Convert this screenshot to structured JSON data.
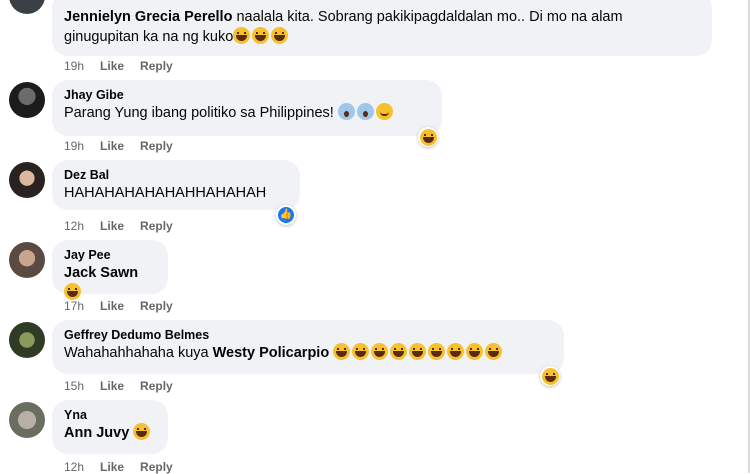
{
  "comments": [
    {
      "author": "Jennielyn Grecia Perello",
      "text_line1": "naalala kita. Sobrang pakikipagdaldalan mo.. Di mo na alam",
      "text_line2": "ginugupitan ka na ng kuko",
      "emojis": [
        "grinning-squint-icon",
        "grinning-squint-icon",
        "grinning-squint-icon"
      ],
      "time": "19h",
      "like_label": "Like",
      "reply_label": "Reply"
    },
    {
      "author": "Jhay Gibe",
      "text": "Parang Yung ibang politiko sa Philippines!",
      "emojis": [
        "screaming-face-icon",
        "fearful-face-icon",
        "smiling-face-icon"
      ],
      "reaction": "laughing-reaction-icon",
      "time": "19h",
      "like_label": "Like",
      "reply_label": "Reply"
    },
    {
      "author": "Dez Bal",
      "text": "HAHAHAHAHAHAHHAHAHAH",
      "reaction": "like-reaction-icon",
      "time": "12h",
      "like_label": "Like",
      "reply_label": "Reply"
    },
    {
      "author": "Jay Pee",
      "mention": "Jack Sawn",
      "emojis": [
        "grinning-squint-icon"
      ],
      "time": "17h",
      "like_label": "Like",
      "reply_label": "Reply"
    },
    {
      "author": "Geffrey Dedumo Belmes",
      "text": "Wahahahhahaha kuya",
      "mention": "Westy Policarpio",
      "emojis": [
        "beaming-face-icon",
        "beaming-face-icon",
        "beaming-face-icon",
        "beaming-face-icon",
        "beaming-face-icon",
        "beaming-face-icon",
        "beaming-face-icon",
        "beaming-face-icon",
        "beaming-face-icon"
      ],
      "reaction": "laughing-reaction-icon",
      "time": "15h",
      "like_label": "Like",
      "reply_label": "Reply"
    },
    {
      "author": "Yna",
      "mention": "Ann Juvy",
      "emojis": [
        "grinning-squint-icon"
      ],
      "time": "12h",
      "like_label": "Like",
      "reply_label": "Reply"
    }
  ]
}
